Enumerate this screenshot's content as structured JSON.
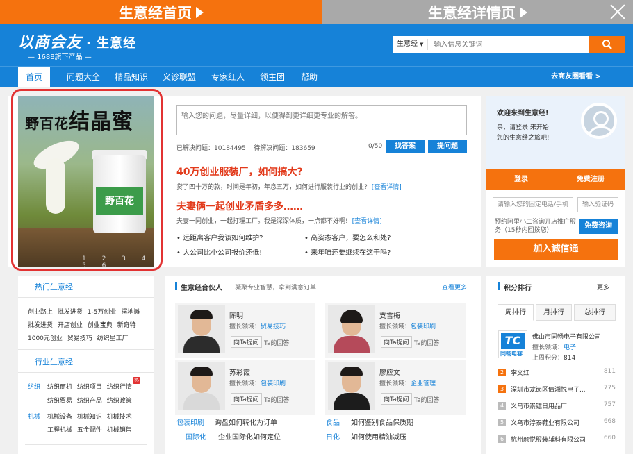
{
  "topbar": {
    "tab1": "生意经首页",
    "tab2": "生意经详情页"
  },
  "header": {
    "logo": "以商会友",
    "logo_sub": "生意经",
    "tagline": "— 1688旗下产品 —"
  },
  "search": {
    "scope": "生意经",
    "placeholder": "输入信息关键词"
  },
  "nav": {
    "items": [
      "首页",
      "问题大全",
      "精品知识",
      "义诊联盟",
      "专家红人",
      "领主团",
      "帮助"
    ],
    "right": "去商友圈看看 >"
  },
  "banner": {
    "title_small": "野百花",
    "title_big": "结晶蜜",
    "label": "野百花",
    "dots": "1 2 3 4 5 6"
  },
  "ask": {
    "placeholder": "输入您的问题，尽量详细，以便得到更详细更专业的解答。",
    "solved_label": "已解决问题：",
    "solved": "10184495",
    "pending_label": "待解决问题：",
    "pending": "183659",
    "counter": "0/50",
    "find_btn": "找答案",
    "ask_btn": "提问题"
  },
  "headlines": [
    {
      "title": "40万创业服装厂，如何搞大?",
      "desc": "贷了四十万的款，时间是年初，年息五万，如何进行服装行业的创业?",
      "link": "[查看详情]"
    },
    {
      "title": "夫妻俩一起创业矛盾多多……",
      "desc": "夫妻一同创业，一起打理工厂。我是深深体质，一点都不好啊!",
      "link": "[查看详情]"
    }
  ],
  "bullets": [
    "远距离客户我该如何维护?",
    "高姿态客户，要怎么和处?",
    "大公司比小公司报价还低!",
    "来年咱还要继续在这干吗?"
  ],
  "login": {
    "welcome": "欢迎来到生意经!",
    "line1": "亲，请登录 来开始",
    "line2": "您的生意经之旅吧!",
    "login_btn": "登录",
    "register_btn": "免费注册",
    "phone_placeholder": "请输入您的固定电话/手机",
    "code_placeholder": "输入验证码",
    "promo": "预约阿里小二咨询开店推广服务（15秒内回拨您）",
    "consult_btn": "免费咨询",
    "join_btn": "加入诚信通"
  },
  "hot": {
    "title": "热门生意经",
    "rows": [
      "创业路上  批发进货  1-5万创业  摆地摊",
      "批发进货  开店创业  创业宝典  新奇特",
      "1000元创业  贸易技巧  纺织星工厂"
    ]
  },
  "industry": {
    "title": "行业生意经",
    "groups": [
      {
        "cat": "纺织",
        "rows": [
          "纺织商机  纺织项目  纺织行情",
          "纺织贸易  纺织产品  纺织政策"
        ]
      },
      {
        "cat": "机械",
        "rows": [
          "机械设备  机械知识  机械技术",
          "工程机械  五金配件  机械销售"
        ]
      }
    ],
    "badge": "热"
  },
  "partners": {
    "title": "生意经合伙人",
    "subtitle": "凝聚专业智慧，拿到满意订单",
    "more": "查看更多",
    "field_label": "擅长领域：",
    "ask_btn": "向Ta提问",
    "answers": "Ta的回答",
    "people": [
      {
        "name": "陈明",
        "field": "贸易技巧"
      },
      {
        "name": "支雪梅",
        "field": "包装印刷"
      },
      {
        "name": "苏彩霞",
        "field": "包装印刷"
      },
      {
        "name": "廖应文",
        "field": "企业管理"
      }
    ],
    "links": [
      {
        "cat": "包装印刷",
        "q": "询盘如何转化为订单"
      },
      {
        "cat": "食品",
        "q": "如何鉴别食品保质期"
      },
      {
        "cat": "国际化",
        "q": "企业国际化如何定位"
      },
      {
        "cat": "日化",
        "q": "如何使用精油减压"
      }
    ]
  },
  "ranking": {
    "title": "积分排行",
    "more": "更多",
    "tabs": [
      "周排行",
      "月排行",
      "总排行"
    ],
    "top": {
      "company": "佛山市同畅电子有限公司",
      "field_label": "擅长领域：",
      "field": "电子",
      "score_label": "上周积分：",
      "score": "814",
      "logo": "TC",
      "logo_sub": "同畅电容"
    },
    "list": [
      {
        "n": "2",
        "name": "李文红",
        "score": "811"
      },
      {
        "n": "3",
        "name": "深圳市龙岗区倩湘悦电子...",
        "score": "775"
      },
      {
        "n": "4",
        "name": "义乌市崇镱日用品厂",
        "score": "757"
      },
      {
        "n": "5",
        "name": "义乌市淳泰鞋业有限公司",
        "score": "668"
      },
      {
        "n": "6",
        "name": "杭州颜悦服装辅料有限公司",
        "score": "660"
      }
    ]
  }
}
